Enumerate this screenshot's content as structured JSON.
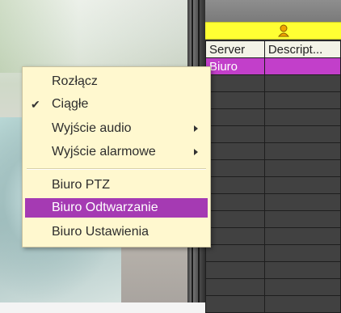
{
  "context_menu": {
    "items": [
      {
        "label": "Rozłącz",
        "checked": false,
        "submenu": false
      },
      {
        "label": "Ciągłe",
        "checked": true,
        "submenu": false
      },
      {
        "label": "Wyjście audio",
        "checked": false,
        "submenu": true
      },
      {
        "label": "Wyjście alarmowe",
        "checked": false,
        "submenu": true
      },
      {
        "label": "Biuro PTZ",
        "checked": false,
        "submenu": false
      },
      {
        "label": "Biuro Odtwarzanie",
        "checked": false,
        "submenu": false,
        "highlighted": true
      },
      {
        "label": "Biuro Ustawienia",
        "checked": false,
        "submenu": false
      }
    ],
    "check_glyph": "✔",
    "highlight_color": "#a53ab3",
    "background_color": "#fff8cf"
  },
  "grid": {
    "header_icon": "user-icon",
    "columns": [
      "Server",
      "Descript..."
    ],
    "rows": [
      [
        "Biuro",
        ""
      ],
      [
        "",
        ""
      ],
      [
        "",
        ""
      ],
      [
        "",
        ""
      ],
      [
        "",
        ""
      ],
      [
        "",
        ""
      ],
      [
        "",
        ""
      ],
      [
        "",
        ""
      ],
      [
        "",
        ""
      ],
      [
        "",
        ""
      ],
      [
        "",
        ""
      ],
      [
        "",
        ""
      ],
      [
        "",
        ""
      ],
      [
        "",
        ""
      ],
      [
        "",
        ""
      ]
    ],
    "selected_row": 0,
    "selected_color": "#c23fca",
    "bar_color": "#ffff33"
  }
}
